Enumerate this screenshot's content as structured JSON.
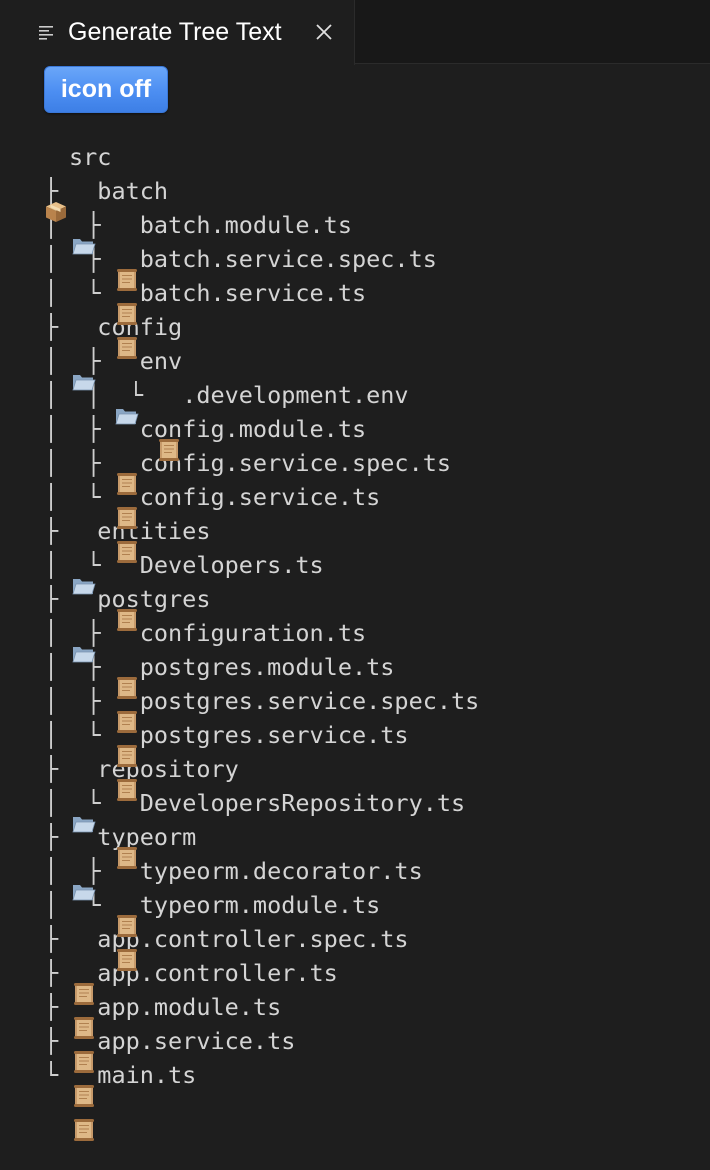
{
  "tab": {
    "title": "Generate Tree Text",
    "icon": "list-icon",
    "close_icon": "close-icon"
  },
  "toggle": {
    "label": "icon off",
    "color": "#4c8ef2"
  },
  "colors": {
    "background": "#1e1e1e",
    "tab_bar": "#181818",
    "text": "#d4d4d4"
  },
  "tree": [
    {
      "prefix": "",
      "icon": "package",
      "name": "src"
    },
    {
      "prefix": "├ ",
      "icon": "folder",
      "name": "batch"
    },
    {
      "prefix": "│  ├ ",
      "icon": "file",
      "name": "batch.module.ts"
    },
    {
      "prefix": "│  ├ ",
      "icon": "file",
      "name": "batch.service.spec.ts"
    },
    {
      "prefix": "│  └ ",
      "icon": "file",
      "name": "batch.service.ts"
    },
    {
      "prefix": "├ ",
      "icon": "folder",
      "name": "config"
    },
    {
      "prefix": "│  ├ ",
      "icon": "folder",
      "name": "env"
    },
    {
      "prefix": "│  │  └ ",
      "icon": "file",
      "name": ".development.env"
    },
    {
      "prefix": "│  ├ ",
      "icon": "file",
      "name": "config.module.ts"
    },
    {
      "prefix": "│  ├ ",
      "icon": "file",
      "name": "config.service.spec.ts"
    },
    {
      "prefix": "│  └ ",
      "icon": "file",
      "name": "config.service.ts"
    },
    {
      "prefix": "├ ",
      "icon": "folder",
      "name": "entities"
    },
    {
      "prefix": "│  └ ",
      "icon": "file",
      "name": "Developers.ts"
    },
    {
      "prefix": "├ ",
      "icon": "folder",
      "name": "postgres"
    },
    {
      "prefix": "│  ├ ",
      "icon": "file",
      "name": "configuration.ts"
    },
    {
      "prefix": "│  ├ ",
      "icon": "file",
      "name": "postgres.module.ts"
    },
    {
      "prefix": "│  ├ ",
      "icon": "file",
      "name": "postgres.service.spec.ts"
    },
    {
      "prefix": "│  └ ",
      "icon": "file",
      "name": "postgres.service.ts"
    },
    {
      "prefix": "├ ",
      "icon": "folder",
      "name": "repository"
    },
    {
      "prefix": "│  └ ",
      "icon": "file",
      "name": "DevelopersRepository.ts"
    },
    {
      "prefix": "├ ",
      "icon": "folder",
      "name": "typeorm"
    },
    {
      "prefix": "│  ├ ",
      "icon": "file",
      "name": "typeorm.decorator.ts"
    },
    {
      "prefix": "│  └ ",
      "icon": "file",
      "name": "typeorm.module.ts"
    },
    {
      "prefix": "├ ",
      "icon": "file",
      "name": "app.controller.spec.ts"
    },
    {
      "prefix": "├ ",
      "icon": "file",
      "name": "app.controller.ts"
    },
    {
      "prefix": "├ ",
      "icon": "file",
      "name": "app.module.ts"
    },
    {
      "prefix": "├ ",
      "icon": "file",
      "name": "app.service.ts"
    },
    {
      "prefix": "└ ",
      "icon": "file",
      "name": "main.ts"
    }
  ]
}
